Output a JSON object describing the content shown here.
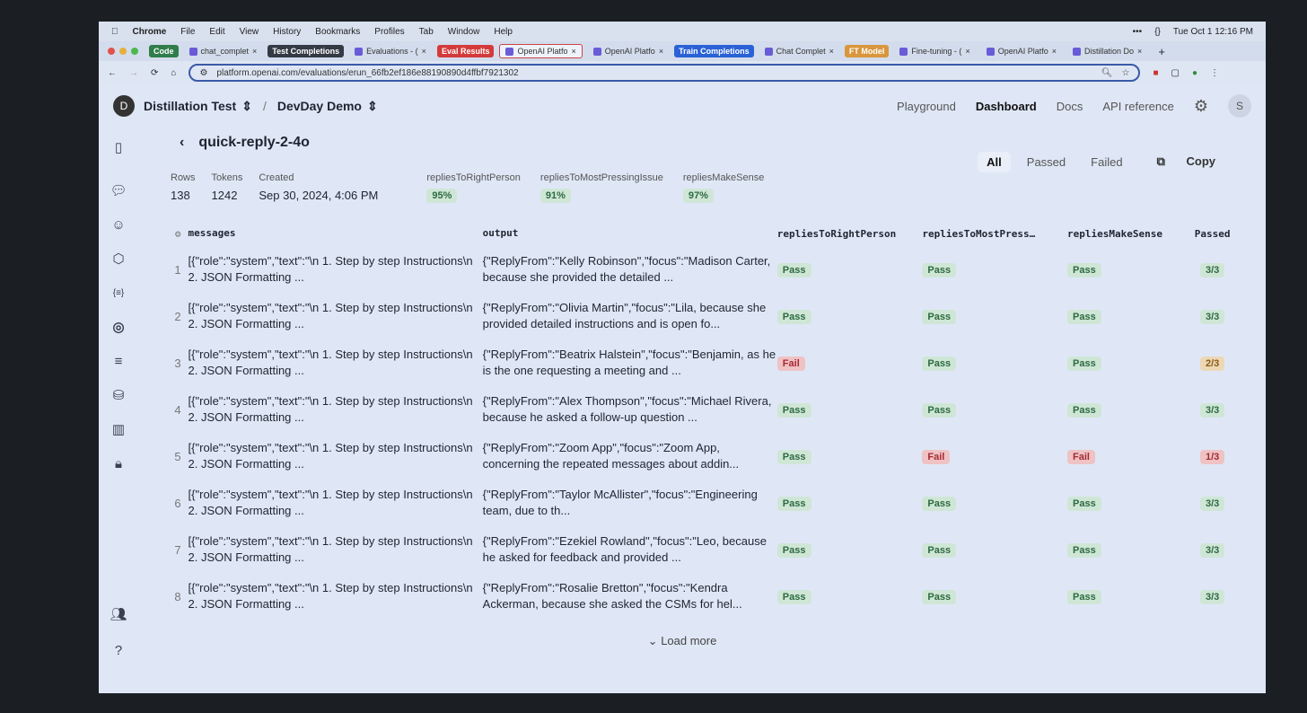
{
  "menubar": {
    "apple": "",
    "items": [
      "Chrome",
      "File",
      "Edit",
      "View",
      "History",
      "Bookmarks",
      "Profiles",
      "Tab",
      "Window",
      "Help"
    ],
    "status": [
      "•••",
      "{}",
      "Tue Oct 1  12:16 PM"
    ]
  },
  "tabs": [
    {
      "type": "group",
      "label": "Code",
      "color": "#2f7d4a"
    },
    {
      "type": "tab",
      "label": "chat_complet"
    },
    {
      "type": "group",
      "label": "Test Completions",
      "color": "#333a44"
    },
    {
      "type": "tab",
      "label": "Evaluations - ("
    },
    {
      "type": "group",
      "label": "Eval Results",
      "color": "#d43a3a"
    },
    {
      "type": "tab",
      "label": "OpenAI Platfo"
    },
    {
      "type": "tab",
      "label": "OpenAI Platfo"
    },
    {
      "type": "group",
      "label": "Train Completions",
      "color": "#2a62d6"
    },
    {
      "type": "tab",
      "label": "Chat Complet"
    },
    {
      "type": "group",
      "label": "FT Model",
      "color": "#d9963c"
    },
    {
      "type": "tab",
      "label": "Fine-tuning - ("
    },
    {
      "type": "tab",
      "label": "OpenAI Platfo"
    },
    {
      "type": "tab",
      "label": "Distillation Do"
    }
  ],
  "url": "platform.openai.com/evaluations/erun_66fb2ef186e88190890d4ffbf7921302",
  "topnav": {
    "org_initial": "D",
    "org": "Distillation Test",
    "project": "DevDay Demo",
    "links": [
      "Playground",
      "Dashboard",
      "Docs",
      "API reference"
    ],
    "active": "Dashboard",
    "user_initial": "S"
  },
  "run": {
    "back": "‹",
    "title": "quick-reply-2-4o"
  },
  "filters": {
    "all": "All",
    "passed": "Passed",
    "failed": "Failed",
    "copy": "Copy"
  },
  "stats": {
    "rows_label": "Rows",
    "rows": "138",
    "tokens_label": "Tokens",
    "tokens": "1242",
    "created_label": "Created",
    "created": "Sep 30, 2024, 4:06 PM",
    "metrics": [
      {
        "label": "repliesToRightPerson",
        "value": "95%"
      },
      {
        "label": "repliesToMostPressingIssue",
        "value": "91%"
      },
      {
        "label": "repliesMakeSense",
        "value": "97%"
      }
    ]
  },
  "table": {
    "headers": [
      "messages",
      "output",
      "repliesToRightPerson",
      "repliesToMostPress…",
      "repliesMakeSense",
      "Passed"
    ],
    "rows": [
      {
        "n": "1",
        "msg": "[{\"role\":\"system\",\"text\":\"\\n   1. Step by step Instructions\\n   2. JSON Formatting ...",
        "out": "{\"ReplyFrom\":\"Kelly Robinson\",\"focus\":\"Madison Carter, because she provided the detailed ...",
        "r": [
          "Pass",
          "Pass",
          "Pass"
        ],
        "passed": "3/3"
      },
      {
        "n": "2",
        "msg": "[{\"role\":\"system\",\"text\":\"\\n   1. Step by step Instructions\\n   2. JSON Formatting ...",
        "out": "{\"ReplyFrom\":\"Olivia Martin\",\"focus\":\"Lila, because she provided detailed instructions and is open fo...",
        "r": [
          "Pass",
          "Pass",
          "Pass"
        ],
        "passed": "3/3"
      },
      {
        "n": "3",
        "msg": "[{\"role\":\"system\",\"text\":\"\\n   1. Step by step Instructions\\n   2. JSON Formatting ...",
        "out": "{\"ReplyFrom\":\"Beatrix Halstein\",\"focus\":\"Benjamin, as he is the one requesting a meeting and ...",
        "r": [
          "Fail",
          "Pass",
          "Pass"
        ],
        "passed": "2/3"
      },
      {
        "n": "4",
        "msg": "[{\"role\":\"system\",\"text\":\"\\n   1. Step by step Instructions\\n   2. JSON Formatting ...",
        "out": "{\"ReplyFrom\":\"Alex Thompson\",\"focus\":\"Michael Rivera, because he asked a follow-up question ...",
        "r": [
          "Pass",
          "Pass",
          "Pass"
        ],
        "passed": "3/3"
      },
      {
        "n": "5",
        "msg": "[{\"role\":\"system\",\"text\":\"\\n   1. Step by step Instructions\\n   2. JSON Formatting ...",
        "out": "{\"ReplyFrom\":\"Zoom App\",\"focus\":\"Zoom App, concerning the repeated messages about addin...",
        "r": [
          "Pass",
          "Fail",
          "Fail"
        ],
        "passed": "1/3"
      },
      {
        "n": "6",
        "msg": "[{\"role\":\"system\",\"text\":\"\\n   1. Step by step Instructions\\n   2. JSON Formatting ...",
        "out": "{\"ReplyFrom\":\"Taylor McAllister\",\"focus\":\"Engineering team, due to th...",
        "r": [
          "Pass",
          "Pass",
          "Pass"
        ],
        "passed": "3/3"
      },
      {
        "n": "7",
        "msg": "[{\"role\":\"system\",\"text\":\"\\n   1. Step by step Instructions\\n   2. JSON Formatting ...",
        "out": "{\"ReplyFrom\":\"Ezekiel Rowland\",\"focus\":\"Leo, because he asked for feedback and provided ...",
        "r": [
          "Pass",
          "Pass",
          "Pass"
        ],
        "passed": "3/3"
      },
      {
        "n": "8",
        "msg": "[{\"role\":\"system\",\"text\":\"\\n   1. Step by step Instructions\\n   2. JSON Formatting ...",
        "out": "{\"ReplyFrom\":\"Rosalie Bretton\",\"focus\":\"Kendra Ackerman, because she asked the CSMs for hel...",
        "r": [
          "Pass",
          "Pass",
          "Pass"
        ],
        "passed": "3/3"
      }
    ]
  },
  "load_more": "Load more",
  "sidebar_icons": [
    "panel-icon",
    "chat-icon",
    "assistant-icon",
    "shapes-icon",
    "braces-icon",
    "compass-icon",
    "sliders-icon",
    "database-icon",
    "chart-icon",
    "lock-icon",
    "users-icon",
    "help-icon"
  ]
}
